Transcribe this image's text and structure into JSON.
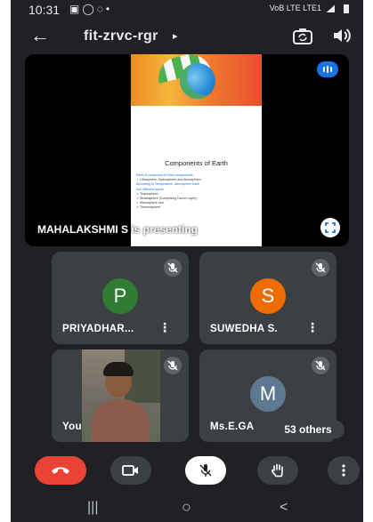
{
  "status_bar": {
    "time": "10:31",
    "icons": [
      "gallery-icon",
      "whatsapp-icon",
      "loop-icon",
      "dot-icon"
    ],
    "network_label": "VoB LTE LTE1",
    "colors": {
      "text": "#e8eaed"
    }
  },
  "app_bar": {
    "meeting_code": "fit-zrvc-rgr",
    "chevron": "▸",
    "back_glyph": "←"
  },
  "presentation": {
    "presenter_text": "MAHALAKSHMI S is presenting",
    "slide": {
      "heading": "Components of Earth",
      "lines": [
        {
          "text": "Earth is composed of three components:",
          "style": "blue"
        },
        {
          "text": "➢ Lithosphere, Hydrosphere and Atmosphere.",
          "style": "dark"
        },
        {
          "text": "According to Temperature, Atmosphere have",
          "style": "blue"
        },
        {
          "text": "four different layers",
          "style": "blue"
        },
        {
          "text": "➢ Troposphere,",
          "style": "dark"
        },
        {
          "text": "➢ Stratosphere (Comprising Ozone Layer),",
          "style": "dark"
        },
        {
          "text": "➢ Mesosphere and",
          "style": "dark"
        },
        {
          "text": "➢ Thermosphere",
          "style": "dark"
        }
      ]
    }
  },
  "participants": [
    {
      "name": "PRIYADHAR...",
      "initial": "P",
      "avatar_color": "#2e7d32",
      "muted": true,
      "menu": "⋮"
    },
    {
      "name": "SUWEDHA S.",
      "initial": "S",
      "avatar_color": "#ef6c00",
      "muted": true,
      "menu": "⋮"
    },
    {
      "name": "You",
      "is_self": true,
      "muted": true
    },
    {
      "name": "Ms.E.GA",
      "initial": "M",
      "avatar_color": "#5f7891",
      "muted": true
    }
  ],
  "others_chip": "53 others",
  "controls": {
    "end_call": "end-call-button",
    "camera": "camera-toggle",
    "mic": "mic-toggle",
    "raise_hand": "raise-hand",
    "more": "more-options"
  },
  "nav_bar": {
    "recents": "|||",
    "home": "○",
    "back": "<"
  },
  "colors": {
    "background": "#202124",
    "tile": "#3c4043",
    "end_call": "#ea4335",
    "accent": "#1a73e8"
  }
}
